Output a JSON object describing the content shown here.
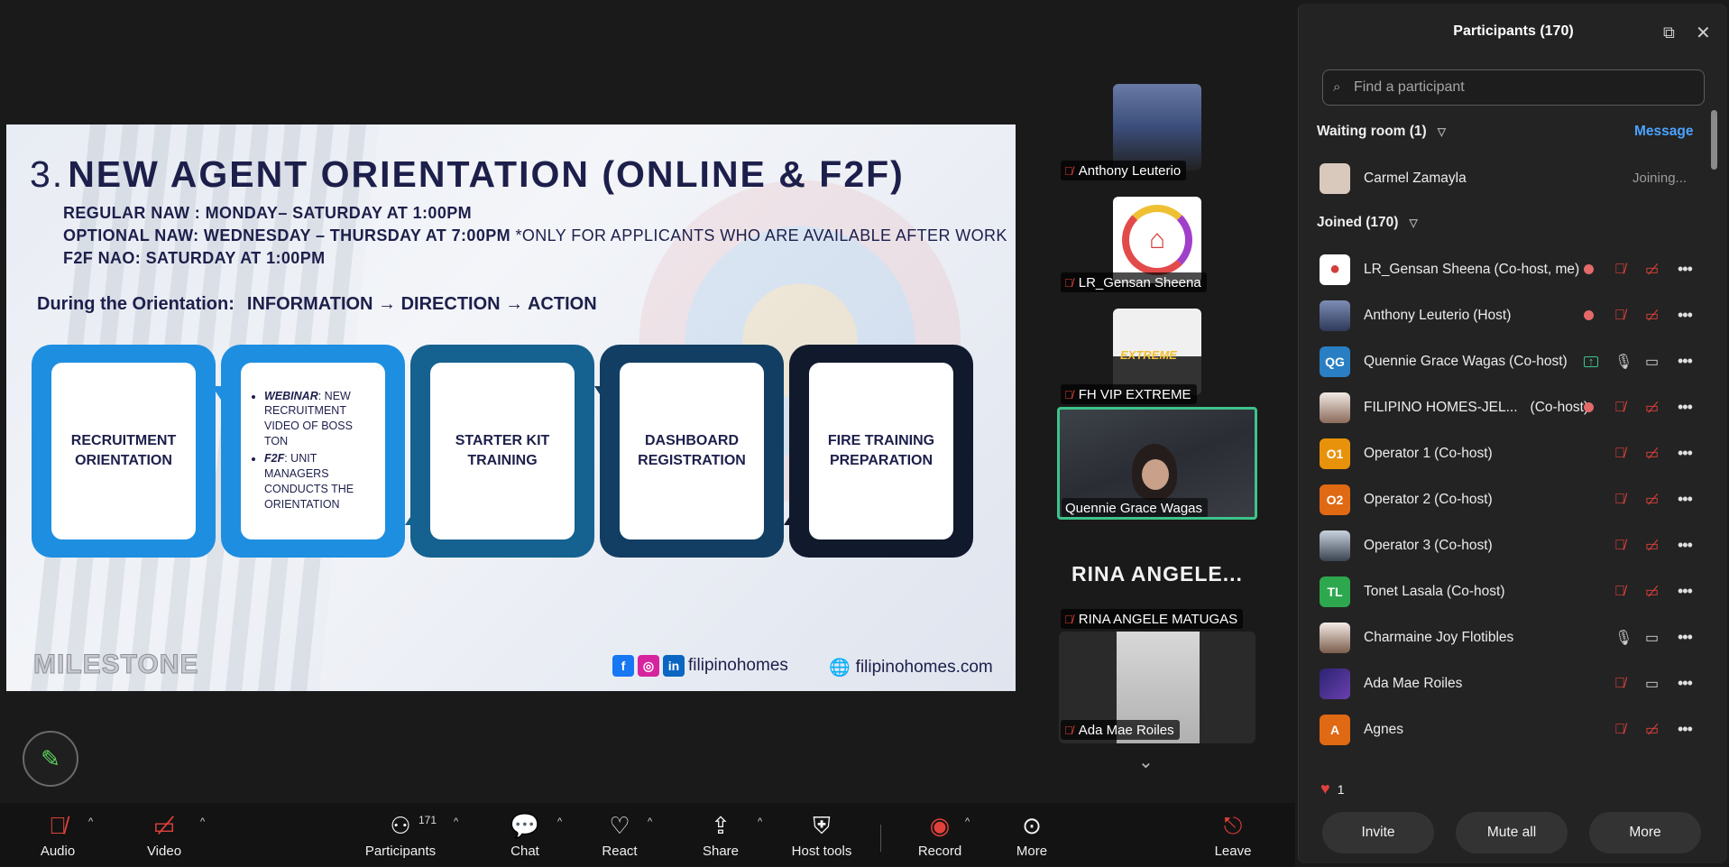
{
  "slide": {
    "title_number": "3.",
    "title": "NEW AGENT ORIENTATION (ONLINE & F2F)",
    "schedule": [
      {
        "text": "REGULAR NAW : MONDAY– SATURDAY AT 1:00PM",
        "note": ""
      },
      {
        "text": "OPTIONAL NAW: WEDNESDAY – THURSDAY AT 7:00PM ",
        "note": "*ONLY FOR APPLICANTS WHO ARE AVAILABLE AFTER WORK"
      },
      {
        "text": "F2F NAO: SATURDAY AT 1:00PM",
        "note": ""
      }
    ],
    "orientation_label": "During the Orientation:",
    "orientation_flow": "INFORMATION → DIRECTION → ACTION",
    "steps": [
      {
        "label": "RECRUITMENT ORIENTATION",
        "color": "#1e8ee0"
      },
      {
        "label": "",
        "color": "#1e8ee0"
      },
      {
        "label": "STARTER KIT TRAINING",
        "color": "#15618f"
      },
      {
        "label": "DASHBOARD REGISTRATION",
        "color": "#123e63"
      },
      {
        "label": "FIRE TRAINING PREPARATION",
        "color": "#111a2c"
      }
    ],
    "step2_items": [
      {
        "head": "WEBINAR",
        "text": ": NEW RECRUITMENT VIDEO OF BOSS TON"
      },
      {
        "head": "F2F",
        "text": ": UNIT MANAGERS CONDUCTS THE ORIENTATION"
      }
    ],
    "footer_logo": "MILESTONE",
    "footer_social": "filipinohomes",
    "footer_web": "filipinohomes.com"
  },
  "video_strip": {
    "tiles": [
      {
        "name": "Anthony Leuterio"
      },
      {
        "name": "LR_Gensan Sheena"
      },
      {
        "name": "FH VIP EXTREME"
      },
      {
        "name": "Quennie Grace Wagas"
      },
      {
        "name": "RINA ANGELE MATUGAS"
      },
      {
        "name": "Ada Mae Roiles"
      }
    ],
    "big_name": "RINA  ANGELE...",
    "badge_text": "EXTREME"
  },
  "panel": {
    "title": "Participants (170)",
    "search_placeholder": "Find a participant",
    "waiting_label": "Waiting room (1)",
    "message_label": "Message",
    "waiting": {
      "name": "Carmel Zamayla",
      "status": "Joining..."
    },
    "joined_label": "Joined (170)",
    "participants": [
      {
        "name": "LR_Gensan Sheena",
        "role": "(Co-host, me)",
        "avatar": "pin",
        "rec": true,
        "mic": "muted",
        "cam": "off"
      },
      {
        "name": "Anthony Leuterio",
        "role": "(Host)",
        "avatar": "photo",
        "rec": true,
        "mic": "muted",
        "cam": "off"
      },
      {
        "name": "Quennie Grace Wagas",
        "role": "(Co-host)",
        "avatar": "QG",
        "share": true,
        "mic": "on",
        "cam": "on",
        "color": "#2a7fc4"
      },
      {
        "name": "FILIPINO HOMES-JEL...",
        "role": "(Co-host)",
        "avatar": "photo",
        "rec": true,
        "mic": "muted",
        "cam": "off"
      },
      {
        "name": "Operator 1",
        "role": "(Co-host)",
        "avatar": "O1",
        "mic": "muted",
        "cam": "off",
        "color": "#e8920c"
      },
      {
        "name": "Operator 2",
        "role": "(Co-host)",
        "avatar": "O2",
        "mic": "muted",
        "cam": "off",
        "color": "#e06914"
      },
      {
        "name": "Operator 3",
        "role": "(Co-host)",
        "avatar": "photo",
        "mic": "muted",
        "cam": "off"
      },
      {
        "name": "Tonet Lasala",
        "role": "(Co-host)",
        "avatar": "TL",
        "mic": "muted",
        "cam": "off",
        "color": "#2ea84f"
      },
      {
        "name": "Charmaine Joy Flotibles",
        "role": "",
        "avatar": "photo",
        "mic": "on",
        "cam": "on"
      },
      {
        "name": "Ada Mae Roiles",
        "role": "",
        "avatar": "photo",
        "mic": "muted",
        "cam": "on"
      },
      {
        "name": "Agnes",
        "role": "",
        "avatar": "A",
        "mic": "muted",
        "cam": "off",
        "color": "#e06914"
      }
    ],
    "reaction_count": "1",
    "buttons": {
      "invite": "Invite",
      "mute_all": "Mute all",
      "more": "More"
    }
  },
  "toolbar": {
    "audio": "Audio",
    "video": "Video",
    "participants": "Participants",
    "participants_count": "171",
    "chat": "Chat",
    "react": "React",
    "share": "Share",
    "host_tools": "Host tools",
    "record": "Record",
    "more": "More",
    "leave": "Leave"
  },
  "colors": {
    "accent": "#4ba3ff",
    "active_border": "#3ec38b",
    "muted": "#e0413b"
  }
}
